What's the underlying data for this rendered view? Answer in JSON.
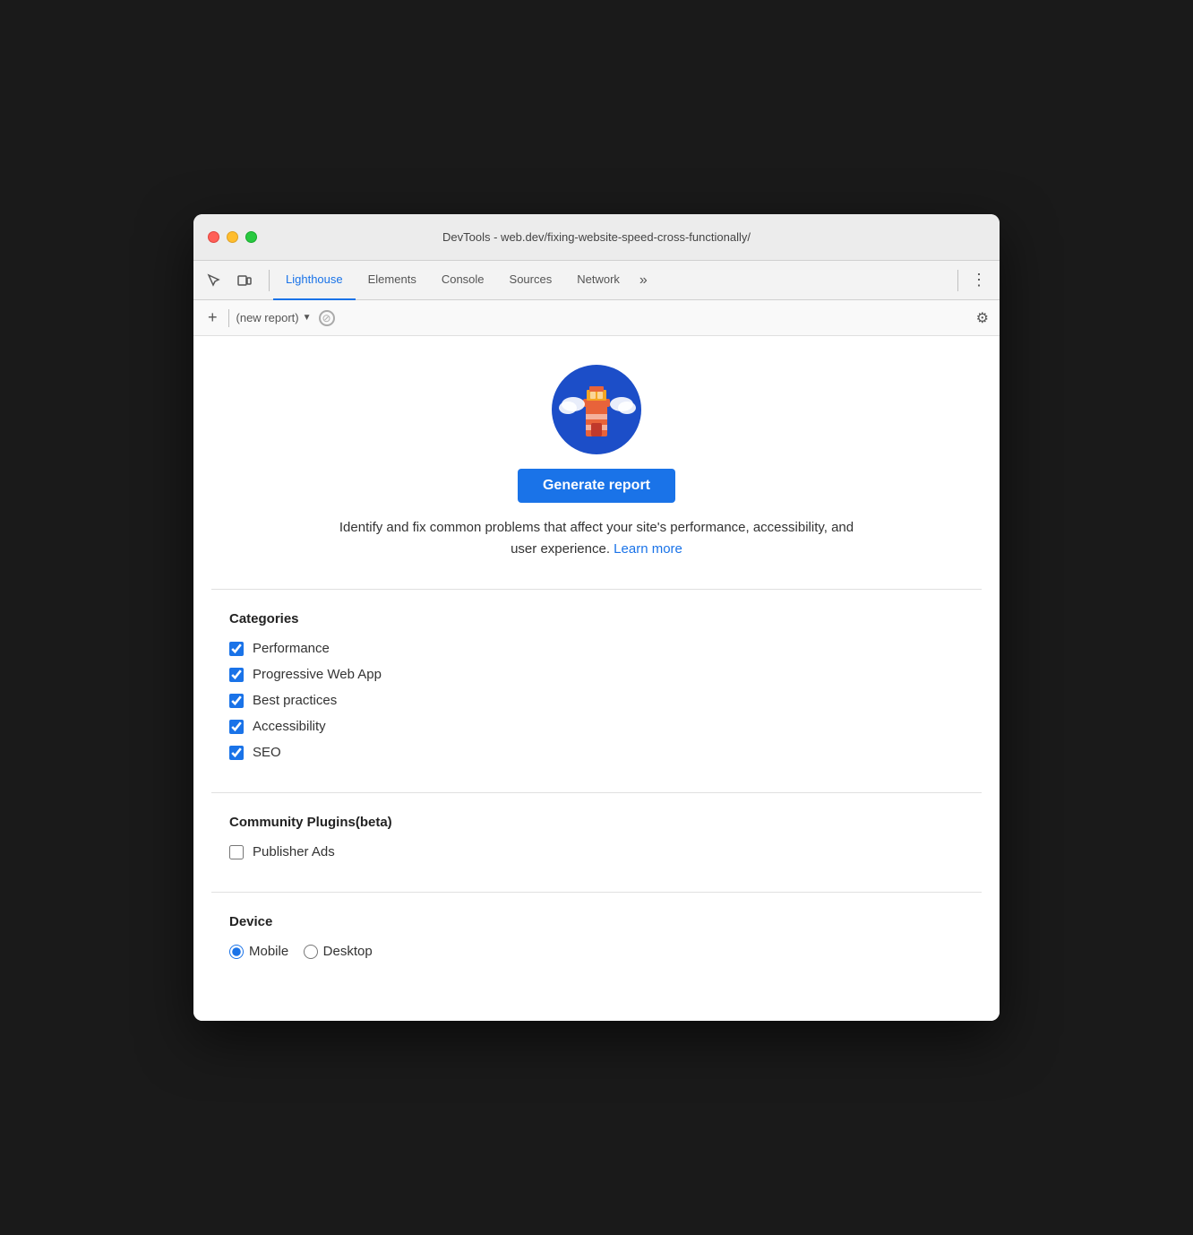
{
  "window": {
    "title": "DevTools - web.dev/fixing-website-speed-cross-functionally/"
  },
  "tabs": {
    "items": [
      {
        "id": "lighthouse",
        "label": "Lighthouse",
        "active": true
      },
      {
        "id": "elements",
        "label": "Elements",
        "active": false
      },
      {
        "id": "console",
        "label": "Console",
        "active": false
      },
      {
        "id": "sources",
        "label": "Sources",
        "active": false
      },
      {
        "id": "network",
        "label": "Network",
        "active": false
      }
    ],
    "more_label": "»"
  },
  "subtoolbar": {
    "plus_label": "+",
    "report_label": "(new report)"
  },
  "hero": {
    "generate_btn_label": "Generate report",
    "description": "Identify and fix common problems that affect your site's performance, accessibility, and user experience.",
    "learn_more_label": "Learn more"
  },
  "categories": {
    "title": "Categories",
    "items": [
      {
        "id": "performance",
        "label": "Performance",
        "checked": true
      },
      {
        "id": "pwa",
        "label": "Progressive Web App",
        "checked": true
      },
      {
        "id": "best-practices",
        "label": "Best practices",
        "checked": true
      },
      {
        "id": "accessibility",
        "label": "Accessibility",
        "checked": true
      },
      {
        "id": "seo",
        "label": "SEO",
        "checked": true
      }
    ]
  },
  "community_plugins": {
    "title": "Community Plugins(beta)",
    "items": [
      {
        "id": "publisher-ads",
        "label": "Publisher Ads",
        "checked": false
      }
    ]
  },
  "device": {
    "title": "Device",
    "items": [
      {
        "id": "mobile",
        "label": "Mobile",
        "selected": true
      },
      {
        "id": "desktop",
        "label": "Desktop",
        "selected": false
      }
    ]
  }
}
